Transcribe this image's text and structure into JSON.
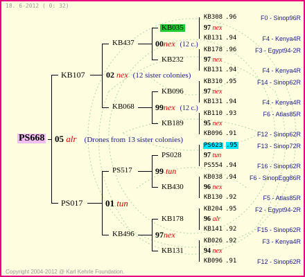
{
  "header": {
    "date": "18.  6-2012 ( 0: 32)"
  },
  "footer": {
    "copyright": "Copyright 2004-2012 @ Karl Kehrle Foundation."
  },
  "root": {
    "id": "PS668"
  },
  "gen1": [
    {
      "year": "05",
      "race": "alr",
      "note": "(Drones from 13 sister colonies)"
    },
    {
      "year": "01",
      "race": "tun"
    }
  ],
  "gen2": [
    {
      "id": "KB107",
      "year": "02",
      "race": "nex",
      "note": "(12 sister colonies)"
    },
    {
      "id": "PS017"
    }
  ],
  "gen3": [
    {
      "id": "KB437",
      "year": "00",
      "race": "nex",
      "note": "(12 c.)"
    },
    {
      "id": "KB068",
      "year": "99",
      "race": "nex",
      "note": "(12 c.)"
    },
    {
      "id": "PS517",
      "year": "99",
      "race": "tun"
    },
    {
      "id": "KB496",
      "year": "97",
      "race": "nex"
    }
  ],
  "gen4": [
    {
      "id": "KB035",
      "year": "97",
      "race": "nex"
    },
    {
      "id": "KB232",
      "year": "97",
      "race": "nex"
    },
    {
      "id": "KB096",
      "year": "97",
      "race": "nex"
    },
    {
      "id": "KB189",
      "year": "95",
      "race": "nex"
    },
    {
      "id": "PS028",
      "year": "97",
      "race": "tun"
    },
    {
      "id": "KB430",
      "year": "96",
      "race": "nex"
    },
    {
      "id": "KB178",
      "year": "96",
      "race": "alr"
    },
    {
      "id": "KB131",
      "year": "94",
      "race": "nex"
    }
  ],
  "leaves": [
    {
      "id": "KB308",
      "y": ".96",
      "origin": "F0 - Sinop96R"
    },
    {
      "id": "KB131",
      "y": ".94",
      "origin": "F4 - Kenya4R"
    },
    {
      "id": "KB178",
      "y": ".96",
      "origin": "F3 - Egypt94-2R"
    },
    {
      "id": "KB131",
      "y": ".94",
      "origin": "F4 - Kenya4R"
    },
    {
      "id": "KB310",
      "y": ".95",
      "origin": "F14 - Sinop62R"
    },
    {
      "id": "KB131",
      "y": ".94",
      "origin": "F4 - Kenya4R"
    },
    {
      "id": "KB110",
      "y": ".93",
      "origin": "F6 - Atlas85R"
    },
    {
      "id": "KB096",
      "y": ".91",
      "origin": "F12 - Sinop62R"
    },
    {
      "id": "PS623",
      "y": ".95",
      "origin": "F13 - Sinop72R"
    },
    {
      "id": "PS554",
      "y": ".94",
      "origin": "F16 - Sinop62R"
    },
    {
      "id": "KB038",
      "y": ".94",
      "origin": "F6 - SinopEgg86R"
    },
    {
      "id": "KB130",
      "y": ".92",
      "origin": "F5 - Atlas85R"
    },
    {
      "id": "KB204",
      "y": ".95",
      "origin": "F2 - Egypt94-2R"
    },
    {
      "id": "KB141",
      "y": ".92",
      "origin": "F15 - Sinop62R"
    },
    {
      "id": "KB026",
      "y": ".92",
      "origin": "F3 - Kenya4R"
    },
    {
      "id": "KB096",
      "y": ".91",
      "origin": "F12 - Sinop62R"
    }
  ],
  "colors": {
    "border": "#e6007e",
    "background": "#fffde0",
    "root_highlight": "#f3bff3",
    "green_highlight": "#22cc33",
    "cyan_highlight": "#00e5ff",
    "race": "#e00000",
    "origin": "#1a1a8c"
  }
}
